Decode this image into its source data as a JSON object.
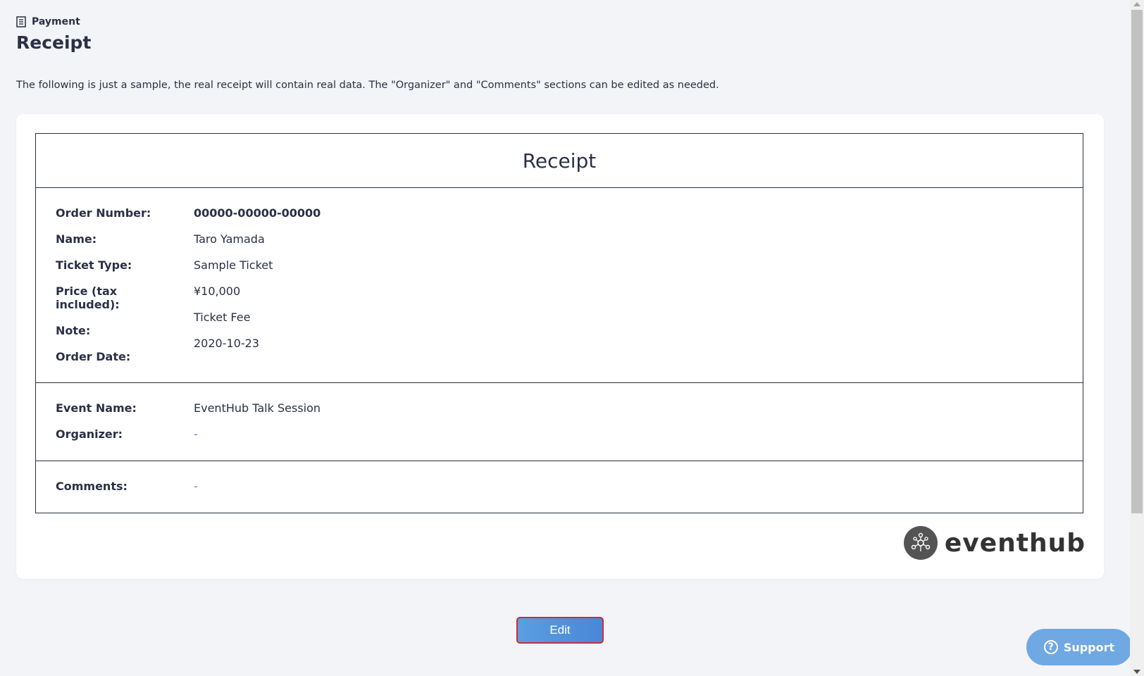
{
  "breadcrumb": {
    "icon": "receipt-icon",
    "label": "Payment"
  },
  "page": {
    "title": "Receipt",
    "description": "The following is just a sample, the real receipt will contain real data. The \"Organizer\" and \"Comments\" sections can be edited as needed."
  },
  "receipt": {
    "heading": "Receipt",
    "order_section": {
      "labels": {
        "order_number": "Order Number:",
        "name": "Name:",
        "ticket_type": "Ticket Type:",
        "price": "Price (tax included):",
        "note": "Note:",
        "order_date": "Order Date:"
      },
      "values": {
        "order_number": "00000-00000-00000",
        "name": "Taro Yamada",
        "ticket_type": "Sample Ticket",
        "price": "¥10,000",
        "note": "Ticket Fee",
        "order_date": "2020-10-23"
      }
    },
    "event_section": {
      "labels": {
        "event_name": "Event Name:",
        "organizer": "Organizer:"
      },
      "values": {
        "event_name": "EventHub Talk Session",
        "organizer": "-"
      }
    },
    "comments_section": {
      "labels": {
        "comments": "Comments:"
      },
      "values": {
        "comments": "-"
      }
    },
    "logo": {
      "text": "eventhub",
      "icon": "eventhub-logo-icon"
    }
  },
  "actions": {
    "edit_label": "Edit",
    "support_label": "Support",
    "support_icon": "question-circle-icon"
  },
  "colors": {
    "background": "#f3f4f7",
    "text": "#2b3045",
    "accent": "#4a87d8",
    "edit_border": "#d7263d",
    "support_bg": "#5a9be0"
  }
}
